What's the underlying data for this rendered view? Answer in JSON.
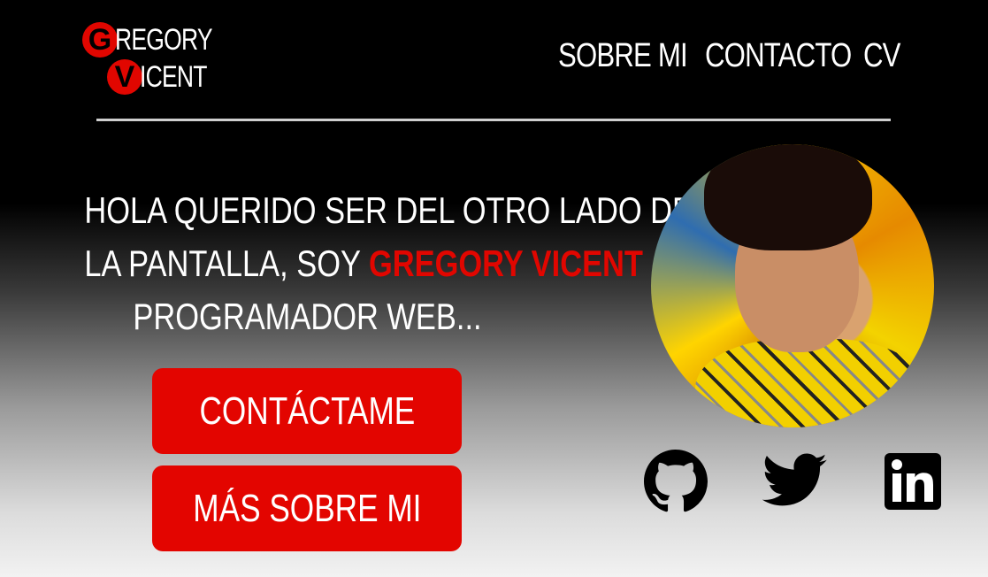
{
  "logo": {
    "line1_letter": "G",
    "line1_rest": "REGORY",
    "line2_letter": "V",
    "line2_rest": "ICENT"
  },
  "nav": {
    "items": [
      "SOBRE MI",
      "CONTACTO",
      "CV"
    ]
  },
  "hero": {
    "line1": "HOLA QUERIDO SER DEL OTRO LADO DE",
    "line2_prefix": "LA PANTALLA, SOY ",
    "name": "GREGORY VICENT",
    "line3": "PROGRAMADOR WEB..."
  },
  "buttons": {
    "contact": "CONTÁCTAME",
    "more": "MÁS SOBRE MI"
  },
  "social": {
    "icons": [
      "github-icon",
      "twitter-icon",
      "linkedin-icon"
    ]
  },
  "colors": {
    "accent": "#e30500",
    "header_bg": "#000000",
    "text": "#ffffff"
  }
}
